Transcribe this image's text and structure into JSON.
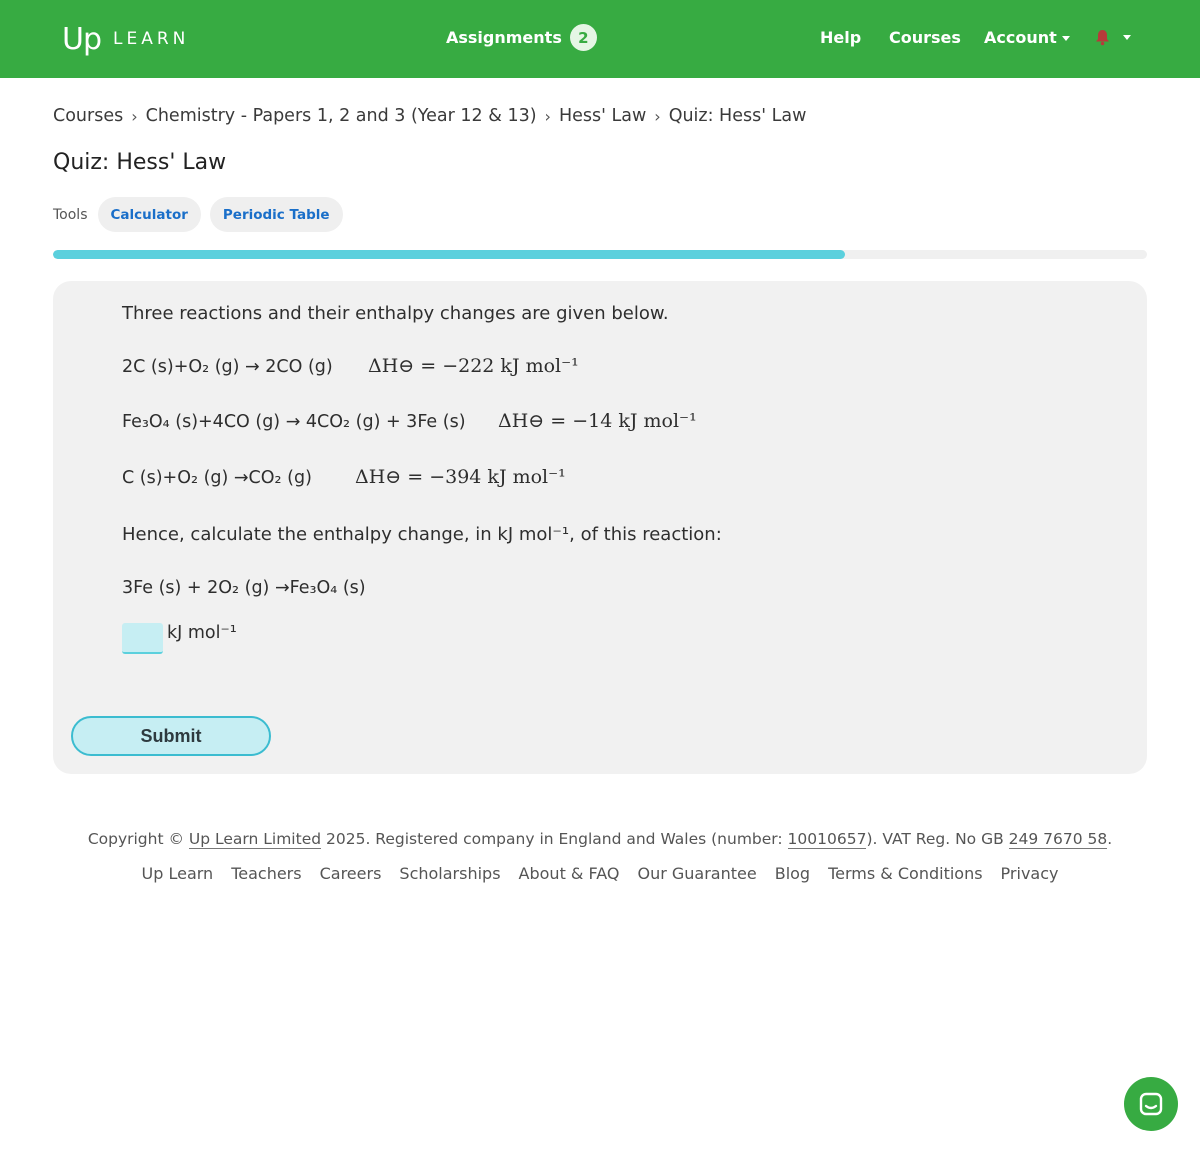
{
  "header": {
    "logo_mark": "Up",
    "logo_text": "LEARN",
    "assignments_label": "Assignments",
    "assignments_count": "2",
    "help": "Help",
    "courses": "Courses",
    "account": "Account",
    "bell_color": "#c0392b",
    "bar_color": "#37ab42"
  },
  "breadcrumb": [
    "Courses",
    "Chemistry - Papers 1, 2 and 3 (Year 12 & 13)",
    "Hess' Law",
    "Quiz: Hess' Law"
  ],
  "page_title": "Quiz: Hess' Law",
  "tools": {
    "label": "Tools",
    "calculator": "Calculator",
    "periodic_table": "Periodic Table"
  },
  "progress": {
    "fraction": 0.724
  },
  "question": {
    "intro": "Three reactions and their enthalpy changes are given below.",
    "reaction1": {
      "equation": "2C (s)+O₂ (g) → 2CO (g)",
      "dh": "ΔH⊖ = −222 kJ mol⁻¹"
    },
    "reaction2": {
      "equation": "Fe₃O₄ (s)+4CO (g) → 4CO₂ (g) + 3Fe (s)",
      "dh": "ΔH⊖ = −14 kJ mol⁻¹"
    },
    "reaction3": {
      "equation": "C (s)+O₂ (g) →CO₂ (g)",
      "dh": "ΔH⊖ = −394 kJ mol⁻¹"
    },
    "prompt": "Hence, calculate the enthalpy change, in kJ mol⁻¹, of this reaction:",
    "target": "3Fe (s) + 2O₂ (g) →Fe₃O₄ (s)",
    "answer_value": "",
    "answer_unit": "kJ mol⁻¹",
    "submit": "Submit"
  },
  "footer": {
    "copyright_prefix": "Copyright © ",
    "company": "Up Learn Limited",
    "copyright_mid": " 2025. Registered company in England and Wales (number: ",
    "company_number": "10010657",
    "copyright_vat": "). VAT Reg. No GB ",
    "vat_number": "249 7670 58",
    "copyright_end": ".",
    "links": [
      "Up Learn",
      "Teachers",
      "Careers",
      "Scholarships",
      "About & FAQ",
      "Our Guarantee",
      "Blog",
      "Terms & Conditions",
      "Privacy"
    ]
  }
}
